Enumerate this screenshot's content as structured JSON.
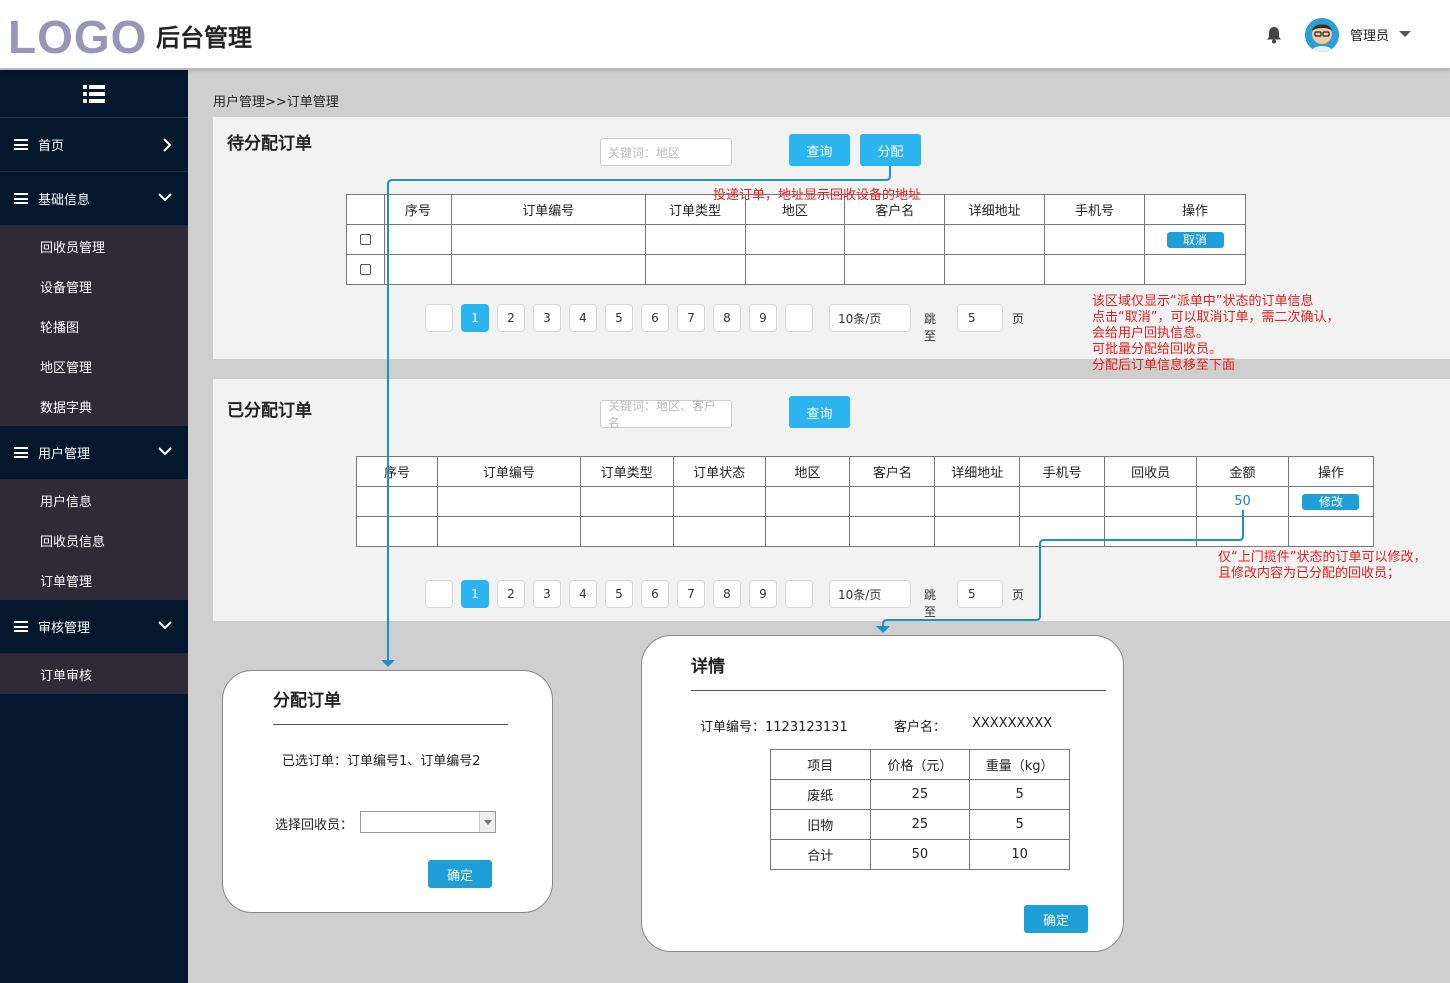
{
  "header": {
    "logo": "LOGO",
    "title": "后台管理",
    "user_name": "管理员"
  },
  "sidebar": {
    "groups": [
      {
        "label": "首页",
        "items": []
      },
      {
        "label": "基础信息",
        "items": [
          "回收员管理",
          "设备管理",
          "轮播图",
          "地区管理",
          "数据字典"
        ]
      },
      {
        "label": "用户管理",
        "items": [
          "用户信息",
          "回收员信息",
          "订单管理"
        ]
      },
      {
        "label": "审核管理",
        "items": [
          "订单审核"
        ]
      }
    ]
  },
  "breadcrumb": "用户管理>>订单管理",
  "pending": {
    "title": "待分配订单",
    "search_placeholder": "关键词：地区",
    "query_label": "查询",
    "assign_label": "分配",
    "columns": [
      "序号",
      "订单编号",
      "订单类型",
      "地区",
      "客户名",
      "详细地址",
      "手机号",
      "操作"
    ],
    "cancel_label": "取消",
    "address_note": "投递订单，地址显示回收设备的地址"
  },
  "pager": {
    "pages": [
      "1",
      "2",
      "3",
      "4",
      "5",
      "6",
      "7",
      "8",
      "9"
    ],
    "page_size": "10条/页",
    "jump_label": "跳至",
    "jump_value": "5",
    "page_suffix": "页"
  },
  "pending_note": [
    "该区域仅显示“派单中”状态的订单信息",
    "点击“取消”，可以取消订单，需二次确认，",
    "会给用户回执信息。",
    "可批量分配给回收员。",
    "分配后订单信息移至下面"
  ],
  "assigned": {
    "title": "已分配订单",
    "search_placeholder": "关键词：地区、客户名",
    "query_label": "查询",
    "columns": [
      "序号",
      "订单编号",
      "订单类型",
      "订单状态",
      "地区",
      "客户名",
      "详细地址",
      "手机号",
      "回收员",
      "金额",
      "操作"
    ],
    "amount": "50",
    "edit_label": "修改"
  },
  "assigned_note": [
    "仅“上门揽件”状态的订单可以修改，",
    "且修改内容为已分配的回收员；"
  ],
  "assign_dialog": {
    "title": "分配订单",
    "selected": "已选订单：订单编号1、订单编号2",
    "collector_label": "选择回收员：",
    "confirm_label": "确定"
  },
  "detail_dialog": {
    "title": "详情",
    "order_no_label": "订单编号：1123123131",
    "customer_label": "客户名：",
    "customer_value": "XXXXXXXXX",
    "columns": [
      "项目",
      "价格（元）",
      "重量（kg）"
    ],
    "rows": [
      [
        "废纸",
        "25",
        "5"
      ],
      [
        "旧物",
        "25",
        "5"
      ],
      [
        "合计",
        "50",
        "10"
      ]
    ],
    "confirm_label": "确定"
  },
  "colors": {
    "accent": "#2bb4ef",
    "sidebar_bg": "#04172d",
    "sidebar_sub_bg": "#2e2a38",
    "note": "#e02020",
    "connector": "#1f8fc6"
  }
}
